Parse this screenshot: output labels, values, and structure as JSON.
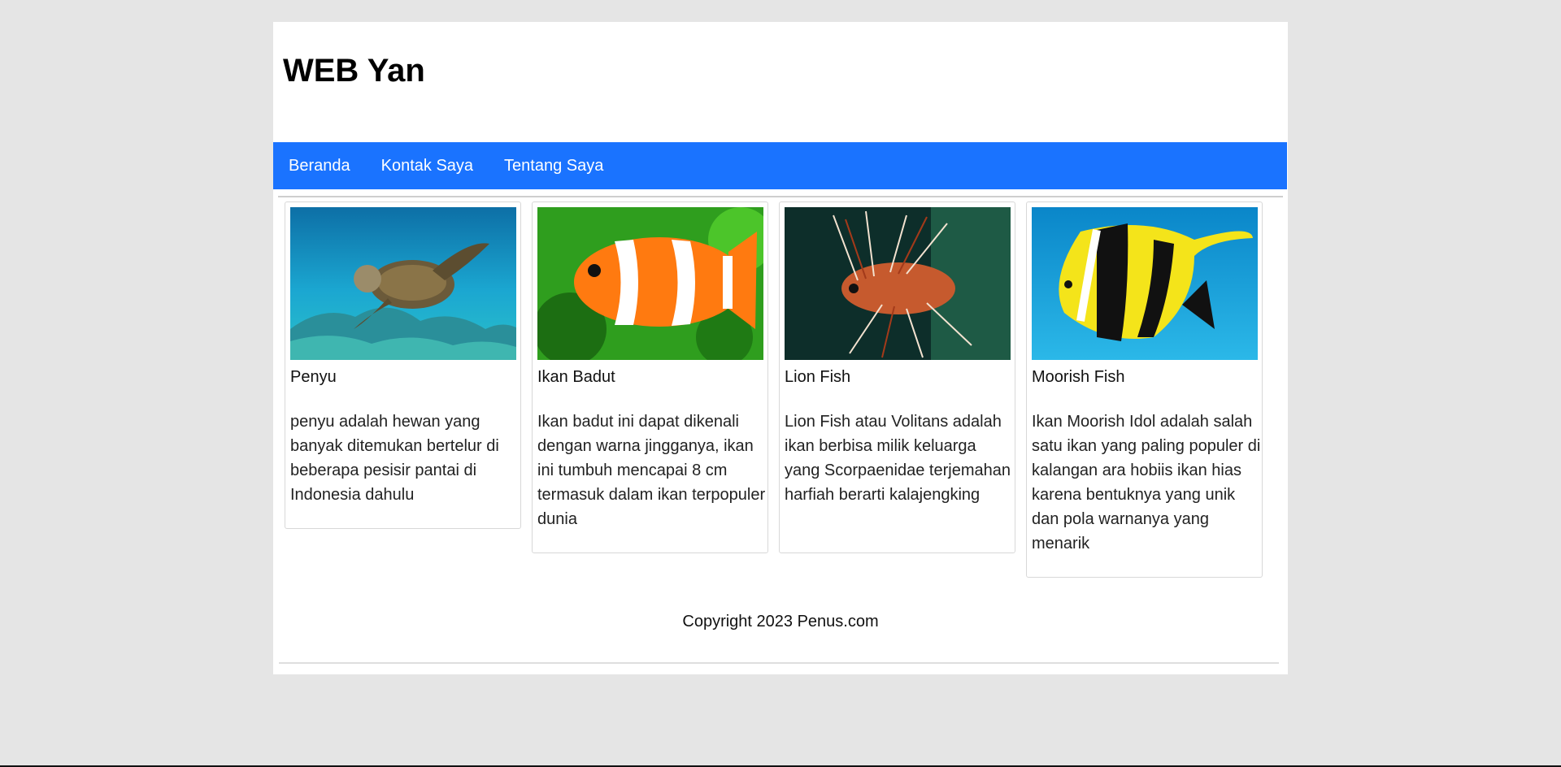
{
  "site": {
    "title": "WEB Yan"
  },
  "nav": {
    "items": [
      {
        "label": "Beranda"
      },
      {
        "label": "Kontak Saya"
      },
      {
        "label": "Tentang Saya"
      }
    ]
  },
  "cards": [
    {
      "title": "Penyu",
      "image": "sea-turtle-photo",
      "text": "penyu adalah hewan yang banyak ditemukan bertelur di beberapa pesisir pantai di Indonesia dahulu"
    },
    {
      "title": "Ikan Badut",
      "image": "clownfish-photo",
      "text": "Ikan badut ini dapat dikenali dengan warna jingganya, ikan ini tumbuh mencapai 8 cm termasuk dalam ikan terpopuler dunia"
    },
    {
      "title": "Lion Fish",
      "image": "lionfish-photo",
      "text": "Lion Fish atau Volitans adalah ikan berbisa milik keluarga yang Scorpaenidae terjemahan harfiah berarti kalajengking"
    },
    {
      "title": "Moorish Fish",
      "image": "moorish-idol-photo",
      "text": "Ikan Moorish Idol adalah salah satu ikan yang paling populer di kalangan ara hobiis ikan hias karena bentuknya yang unik dan pola warnanya yang menarik"
    }
  ],
  "footer": {
    "copyright": "Copyright 2023 Penus.com"
  },
  "colors": {
    "page_background": "#e5e5e5",
    "navbar": "#1a73ff",
    "content_background": "#ffffff"
  }
}
